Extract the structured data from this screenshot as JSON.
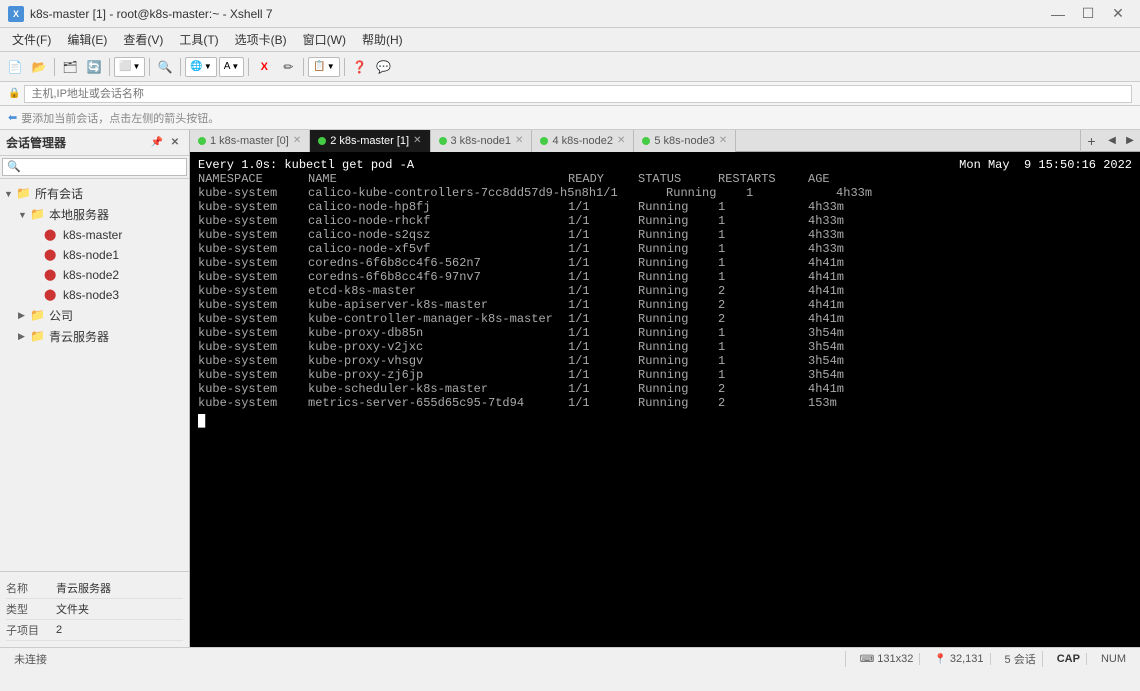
{
  "window": {
    "title": "k8s-master [1] - root@k8s-master:~ - Xshell 7",
    "icon_text": "X"
  },
  "title_controls": {
    "minimize": "—",
    "maximize": "☐",
    "close": "✕"
  },
  "menu": {
    "items": [
      "文件(F)",
      "编辑(E)",
      "查看(V)",
      "工具(T)",
      "选项卡(B)",
      "窗口(W)",
      "帮助(H)"
    ]
  },
  "address_bar": {
    "placeholder": "主机,IP地址或会话名称"
  },
  "session_bar": {
    "text": "要添加当前会话，点击左侧的箭头按钮。"
  },
  "sidebar": {
    "title": "会话管理器",
    "tree": [
      {
        "label": "所有会话",
        "level": 0,
        "type": "folder",
        "expanded": true
      },
      {
        "label": "本地服务器",
        "level": 1,
        "type": "folder",
        "expanded": true
      },
      {
        "label": "k8s-master",
        "level": 2,
        "type": "server"
      },
      {
        "label": "k8s-node1",
        "level": 2,
        "type": "server"
      },
      {
        "label": "k8s-node2",
        "level": 2,
        "type": "server"
      },
      {
        "label": "k8s-node3",
        "level": 2,
        "type": "server"
      },
      {
        "label": "公司",
        "level": 1,
        "type": "folder",
        "expanded": false
      },
      {
        "label": "青云服务器",
        "level": 1,
        "type": "folder",
        "expanded": false
      }
    ]
  },
  "properties": {
    "rows": [
      {
        "label": "名称",
        "value": "青云服务器"
      },
      {
        "label": "类型",
        "value": "文件夹"
      },
      {
        "label": "子项目",
        "value": "2"
      }
    ]
  },
  "tabs": [
    {
      "id": 1,
      "label": "1 k8s-master [0]",
      "active": false,
      "dot": true
    },
    {
      "id": 2,
      "label": "2 k8s-master [1]",
      "active": true,
      "dot": true
    },
    {
      "id": 3,
      "label": "3 k8s-node1",
      "active": false,
      "dot": true
    },
    {
      "id": 4,
      "label": "4 k8s-node2",
      "active": false,
      "dot": true
    },
    {
      "id": 5,
      "label": "5 k8s-node3",
      "active": false,
      "dot": true
    }
  ],
  "terminal": {
    "command_line": "Every 1.0s: kubectl get pod -A",
    "timestamp": "Mon May  9 15:50:16 2022",
    "headers": [
      "NAMESPACE",
      "NAME",
      "READY",
      "STATUS",
      "RESTARTS",
      "AGE"
    ],
    "rows": [
      [
        "kube-system",
        "calico-kube-controllers-7cc8dd57d9-h5n8h",
        "1/1",
        "Running",
        "1",
        "4h33m"
      ],
      [
        "kube-system",
        "calico-node-hp8fj",
        "1/1",
        "Running",
        "1",
        "4h33m"
      ],
      [
        "kube-system",
        "calico-node-rhckf",
        "1/1",
        "Running",
        "1",
        "4h33m"
      ],
      [
        "kube-system",
        "calico-node-s2qsz",
        "1/1",
        "Running",
        "1",
        "4h33m"
      ],
      [
        "kube-system",
        "calico-node-xf5vf",
        "1/1",
        "Running",
        "1",
        "4h33m"
      ],
      [
        "kube-system",
        "coredns-6f6b8cc4f6-562n7",
        "1/1",
        "Running",
        "1",
        "4h41m"
      ],
      [
        "kube-system",
        "coredns-6f6b8cc4f6-97nv7",
        "1/1",
        "Running",
        "1",
        "4h41m"
      ],
      [
        "kube-system",
        "etcd-k8s-master",
        "1/1",
        "Running",
        "2",
        "4h41m"
      ],
      [
        "kube-system",
        "kube-apiserver-k8s-master",
        "1/1",
        "Running",
        "2",
        "4h41m"
      ],
      [
        "kube-system",
        "kube-controller-manager-k8s-master",
        "1/1",
        "Running",
        "2",
        "4h41m"
      ],
      [
        "kube-system",
        "kube-proxy-db85n",
        "1/1",
        "Running",
        "1",
        "3h54m"
      ],
      [
        "kube-system",
        "kube-proxy-v2jxc",
        "1/1",
        "Running",
        "1",
        "3h54m"
      ],
      [
        "kube-system",
        "kube-proxy-vhsgv",
        "1/1",
        "Running",
        "1",
        "3h54m"
      ],
      [
        "kube-system",
        "kube-proxy-zj6jp",
        "1/1",
        "Running",
        "1",
        "3h54m"
      ],
      [
        "kube-system",
        "kube-scheduler-k8s-master",
        "1/1",
        "Running",
        "2",
        "4h41m"
      ],
      [
        "kube-system",
        "metrics-server-655d65c95-7td94",
        "1/1",
        "Running",
        "2",
        "153m"
      ]
    ]
  },
  "status_bar": {
    "connected": "未连接",
    "dimensions": "131x32",
    "position": "32,131",
    "sessions": "5 会话",
    "cap": "CAP",
    "num": "NUM"
  }
}
